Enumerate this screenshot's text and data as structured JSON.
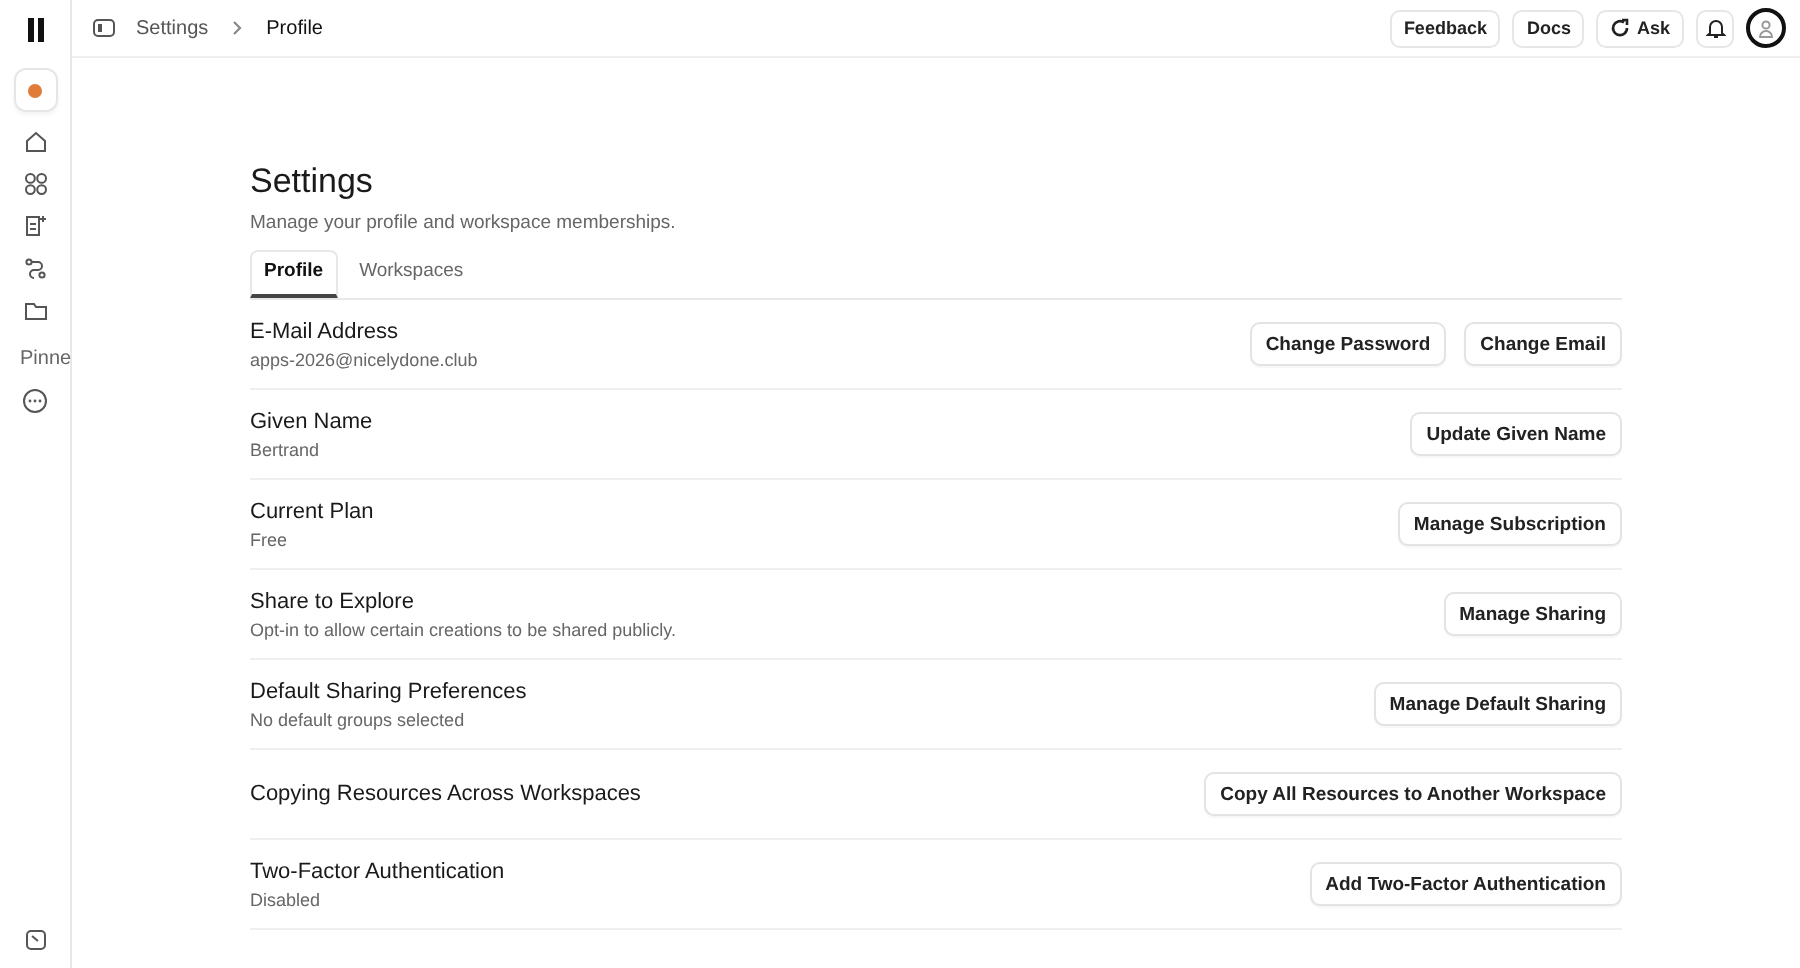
{
  "breadcrumb": [
    {
      "label": "Settings"
    },
    {
      "label": "Profile"
    }
  ],
  "top_actions": [
    {
      "label": "Feedback",
      "kind": "text"
    },
    {
      "label": "Docs",
      "kind": "text"
    },
    {
      "label": "Ask",
      "kind": "ask"
    },
    {
      "kind": "bell"
    }
  ],
  "sidebar": {
    "pinned_label": "Pinne"
  },
  "page": {
    "title": "Settings",
    "subtitle": "Manage your profile and workspace memberships."
  },
  "tabs": [
    {
      "label": "Profile",
      "selected": true
    },
    {
      "label": "Workspaces",
      "selected": false
    }
  ],
  "rows": [
    {
      "title": "E-Mail Address",
      "detail": "apps-2026@nicelydone.club",
      "buttons": [
        "Change Password",
        "Change Email"
      ]
    },
    {
      "title": "Given Name",
      "detail": "Bertrand",
      "buttons": [
        "Update Given Name"
      ]
    },
    {
      "title": "Current Plan",
      "detail": "Free",
      "buttons": [
        "Manage Subscription"
      ]
    },
    {
      "title": "Share to Explore",
      "detail": "Opt-in to allow certain creations to be shared publicly.",
      "buttons": [
        "Manage Sharing"
      ]
    },
    {
      "title": "Default Sharing Preferences",
      "detail": "No default groups selected",
      "buttons": [
        "Manage Default Sharing"
      ]
    },
    {
      "title": "Copying Resources Across Workspaces",
      "buttons": [
        "Copy All Resources to Another Workspace"
      ]
    },
    {
      "title": "Two-Factor Authentication",
      "detail": "Disabled",
      "buttons": [
        "Add Two-Factor Authentication"
      ]
    }
  ]
}
